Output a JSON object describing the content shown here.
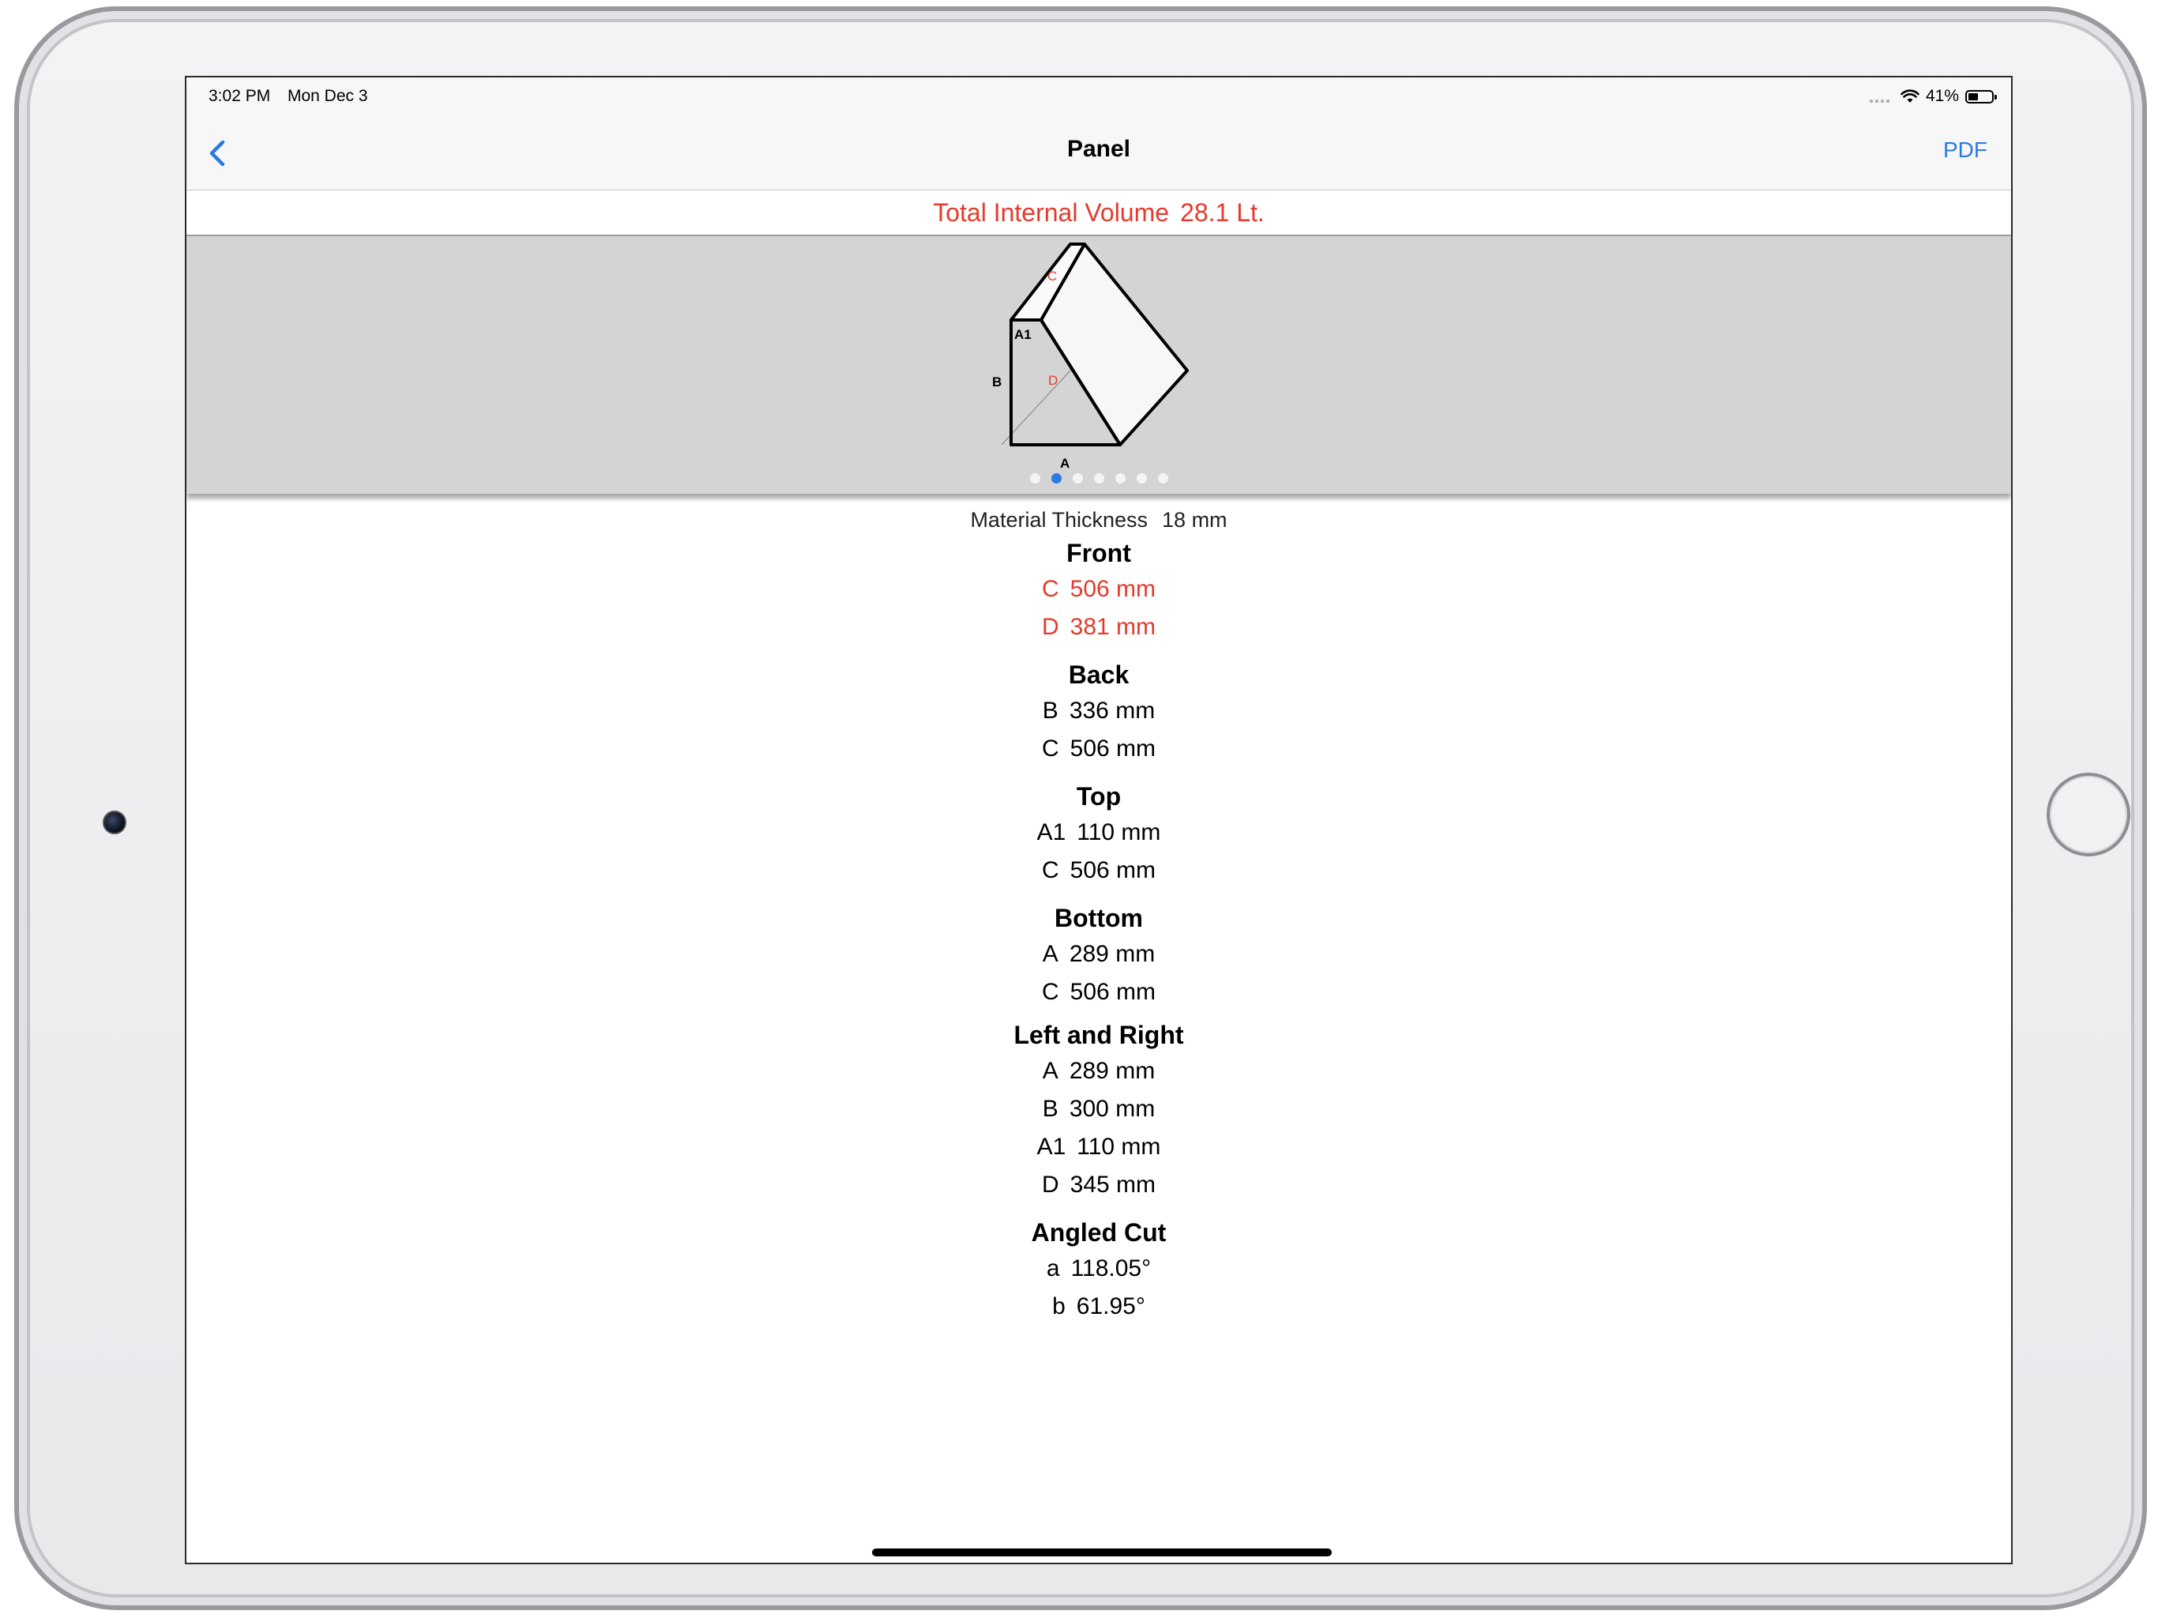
{
  "status_bar": {
    "time": "3:02 PM",
    "date": "Mon Dec 3",
    "battery": "41%"
  },
  "nav": {
    "title": "Panel",
    "pdf_label": "PDF"
  },
  "volume": {
    "label": "Total Internal Volume",
    "value": "28.1 Lt."
  },
  "diagram": {
    "labels": {
      "a": "A",
      "a1": "A1",
      "b": "B",
      "c": "C",
      "d": "D"
    },
    "page_count": 7,
    "active_page": 2
  },
  "material": {
    "label": "Material Thickness",
    "value": "18 mm"
  },
  "sections": {
    "front": {
      "title": "Front",
      "rows": [
        {
          "key": "C",
          "value": "506 mm"
        },
        {
          "key": "D",
          "value": "381 mm"
        }
      ]
    },
    "back": {
      "title": "Back",
      "rows": [
        {
          "key": "B",
          "value": "336 mm"
        },
        {
          "key": "C",
          "value": "506 mm"
        }
      ]
    },
    "top": {
      "title": "Top",
      "rows": [
        {
          "key": "A1",
          "value": "110 mm"
        },
        {
          "key": "C",
          "value": "506 mm"
        }
      ]
    },
    "bottom": {
      "title": "Bottom",
      "rows": [
        {
          "key": "A",
          "value": "289 mm"
        },
        {
          "key": "C",
          "value": "506 mm"
        }
      ]
    },
    "left_right": {
      "title": "Left and Right",
      "rows": [
        {
          "key": "A",
          "value": "289 mm"
        },
        {
          "key": "B",
          "value": "300 mm"
        },
        {
          "key": "A1",
          "value": "110 mm"
        },
        {
          "key": "D",
          "value": "345 mm"
        }
      ]
    },
    "angled_cut": {
      "title": "Angled Cut",
      "rows": [
        {
          "key": "a",
          "value": "118.05°"
        },
        {
          "key": "b",
          "value": "61.95°"
        }
      ]
    }
  },
  "colors": {
    "accent": "#2a7ae2",
    "highlight": "#e53a2c",
    "diagram_bg": "#d4d4d4"
  }
}
